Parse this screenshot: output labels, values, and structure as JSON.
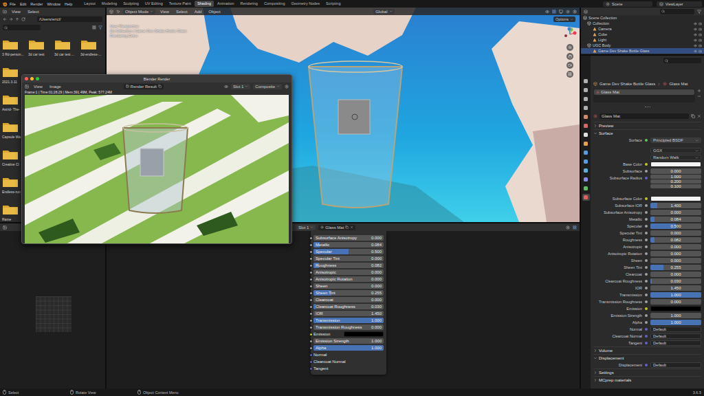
{
  "topbar": {
    "menus": [
      "File",
      "Edit",
      "Render",
      "Window",
      "Help"
    ],
    "workspaces": [
      {
        "label": "Layout",
        "selected": false
      },
      {
        "label": "Modeling",
        "selected": false
      },
      {
        "label": "Sculpting",
        "selected": false
      },
      {
        "label": "UV Editing",
        "selected": false
      },
      {
        "label": "Texture Paint",
        "selected": false
      },
      {
        "label": "Shading",
        "selected": true
      },
      {
        "label": "Animation",
        "selected": false
      },
      {
        "label": "Rendering",
        "selected": false
      },
      {
        "label": "Compositing",
        "selected": false
      },
      {
        "label": "Geometry Nodes",
        "selected": false
      },
      {
        "label": "Scripting",
        "selected": false
      }
    ],
    "scene": "Scene",
    "view_layer": "ViewLayer"
  },
  "file_browser": {
    "menus": [
      "View",
      "Select"
    ],
    "path": "/Users/ericl/",
    "rows": [
      [
        "3 Rd-person...",
        "3d car test",
        "3d car test ...",
        "3d-endless-..."
      ],
      [
        "2021.3.11"
      ],
      [
        "Astrid- The-"
      ],
      [
        "Capsule Wa"
      ],
      [
        "Creative Cl"
      ],
      [
        "Endless-run"
      ],
      [
        "Rame"
      ]
    ]
  },
  "viewport": {
    "mode": "Object Mode",
    "menus": [
      "View",
      "Select",
      "Add",
      "Object"
    ],
    "orientation": "Global",
    "options": "Options",
    "overlay": [
      "User Perspective",
      "(1) Collection | Game Dev Shake Bottle Glass",
      "Rendering Done"
    ]
  },
  "render_window": {
    "title": "Blender Render",
    "menus": [
      "View",
      "Image"
    ],
    "image": "Render Result",
    "slot": "Slot 1",
    "pass": "Composite",
    "info": "Frame:1 | Time:01:28.29 | Mem:391.49M, Peak: 577.24M"
  },
  "node_editor": {
    "slot": "Slot 1",
    "material": "Glass Mat",
    "rows": [
      {
        "kind": "slider",
        "label": "Subsurface Anisotropy",
        "value": "0.000",
        "level": 0
      },
      {
        "kind": "slider",
        "label": "Metallic",
        "value": "0.084",
        "level": 0.084
      },
      {
        "kind": "slider",
        "label": "Specular",
        "value": "0.500",
        "level": 0.5
      },
      {
        "kind": "slider",
        "label": "Specular Tint",
        "value": "0.000",
        "level": 0
      },
      {
        "kind": "slider",
        "label": "Roughness",
        "value": "0.082",
        "level": 0.082
      },
      {
        "kind": "slider",
        "label": "Anisotropic",
        "value": "0.000",
        "level": 0
      },
      {
        "kind": "slider",
        "label": "Anisotropic Rotation",
        "value": "0.000",
        "level": 0
      },
      {
        "kind": "slider",
        "label": "Sheen",
        "value": "0.000",
        "level": 0
      },
      {
        "kind": "slider",
        "label": "Sheen Tint",
        "value": "0.255",
        "level": 0.255
      },
      {
        "kind": "slider",
        "label": "Clearcoat",
        "value": "0.000",
        "level": 0
      },
      {
        "kind": "slider",
        "label": "Clearcoat Roughness",
        "value": "0.030",
        "level": 0.03
      },
      {
        "kind": "number",
        "label": "IOR",
        "value": "1.450"
      },
      {
        "kind": "slider",
        "label": "Transmission",
        "value": "1.000",
        "level": 1
      },
      {
        "kind": "slider",
        "label": "Transmission Roughness",
        "value": "0.000",
        "level": 0
      },
      {
        "kind": "color",
        "label": "Emission",
        "color": "#000000"
      },
      {
        "kind": "number",
        "label": "Emission Strength",
        "value": "1.000"
      },
      {
        "kind": "slider",
        "label": "Alpha",
        "value": "1.000",
        "level": 1
      },
      {
        "kind": "socket",
        "label": "Normal"
      },
      {
        "kind": "socket",
        "label": "Clearcoat Normal"
      },
      {
        "kind": "socket",
        "label": "Tangent"
      }
    ]
  },
  "outliner": {
    "items": [
      {
        "label": "Scene Collection",
        "kind": "root",
        "selected": false
      },
      {
        "label": "Collection",
        "kind": "collection",
        "selected": false
      },
      {
        "label": "Camera",
        "kind": "object",
        "selected": false
      },
      {
        "label": "Cube",
        "kind": "object",
        "selected": false
      },
      {
        "label": "Light",
        "kind": "object",
        "selected": false
      },
      {
        "label": "UGC Body",
        "kind": "collection",
        "selected": false
      },
      {
        "label": "Game Dev Shake Bottle Glass",
        "kind": "object",
        "selected": true
      }
    ]
  },
  "properties": {
    "tabs": [
      {
        "color": "#b0b0b0",
        "selected": false
      },
      {
        "color": "#b0b0b0",
        "selected": false
      },
      {
        "color": "#b0b0b0",
        "selected": false
      },
      {
        "color": "#b0b0b0",
        "selected": false
      },
      {
        "color": "#d08a6a",
        "selected": false
      },
      {
        "color": "#d06a6a",
        "selected": false
      },
      {
        "color": "#e0e0e0",
        "selected": false
      },
      {
        "color": "#e8a050",
        "selected": false
      },
      {
        "color": "#5a9ae0",
        "selected": false
      },
      {
        "color": "#5a9ae0",
        "selected": false
      },
      {
        "color": "#5ab0e0",
        "selected": false
      },
      {
        "color": "#8a8ae0",
        "selected": false
      },
      {
        "color": "#60c060",
        "selected": false
      },
      {
        "color": "#e06060",
        "selected": true
      }
    ],
    "breadcrumb": [
      "Game Dev Shake Bottle Glass",
      "Glass Mat"
    ],
    "slots": [
      {
        "label": "Glass Mat",
        "selected": true
      }
    ],
    "material": "Glass Mat",
    "rows": [
      {
        "kind": "section",
        "label": "Preview",
        "expanded": false
      },
      {
        "kind": "section",
        "label": "Surface",
        "expanded": true
      },
      {
        "kind": "shader",
        "label": "Surface",
        "value": "Principled BSDF"
      },
      {
        "kind": "select",
        "value": "GGX"
      },
      {
        "kind": "select",
        "value": "Random Walk"
      },
      {
        "kind": "color",
        "label": "Base Color",
        "color": "#f2f2f2"
      },
      {
        "kind": "slider",
        "label": "Subsurface",
        "value": "0.000",
        "level": 0
      },
      {
        "kind": "vector",
        "label": "Subsurface Radius",
        "values": [
          "1.000",
          "0.200",
          "0.100"
        ]
      },
      {
        "kind": "color",
        "label": "Subsurface Color",
        "color": "#f2f2f2"
      },
      {
        "kind": "slider",
        "label": "Subsurface IOR",
        "value": "1.400",
        "level": 0.14
      },
      {
        "kind": "slider",
        "label": "Subsurface Anisotropy",
        "value": "0.000",
        "level": 0
      },
      {
        "kind": "slider",
        "label": "Metallic",
        "value": "0.084",
        "level": 0.084
      },
      {
        "kind": "slider",
        "label": "Specular",
        "value": "0.500",
        "level": 0.5
      },
      {
        "kind": "slider",
        "label": "Specular Tint",
        "value": "0.000",
        "level": 0
      },
      {
        "kind": "slider",
        "label": "Roughness",
        "value": "0.082",
        "level": 0.082
      },
      {
        "kind": "slider",
        "label": "Anisotropic",
        "value": "0.000",
        "level": 0
      },
      {
        "kind": "slider",
        "label": "Anisotropic Rotation",
        "value": "0.000",
        "level": 0
      },
      {
        "kind": "slider",
        "label": "Sheen",
        "value": "0.000",
        "level": 0
      },
      {
        "kind": "slider",
        "label": "Sheen Tint",
        "value": "0.255",
        "level": 0.255
      },
      {
        "kind": "slider",
        "label": "Clearcoat",
        "value": "0.000",
        "level": 0
      },
      {
        "kind": "slider",
        "label": "Clearcoat Roughness",
        "value": "0.030",
        "level": 0.03
      },
      {
        "kind": "number",
        "label": "IOR",
        "value": "1.450"
      },
      {
        "kind": "slider",
        "label": "Transmission",
        "value": "1.000",
        "level": 1
      },
      {
        "kind": "slider",
        "label": "Transmission Roughness",
        "value": "0.000",
        "level": 0
      },
      {
        "kind": "color",
        "label": "Emission",
        "color": "#000000"
      },
      {
        "kind": "number",
        "label": "Emission Strength",
        "value": "1.000"
      },
      {
        "kind": "slider",
        "label": "Alpha",
        "value": "1.000",
        "level": 1
      },
      {
        "kind": "link",
        "label": "Normal",
        "value": "Default"
      },
      {
        "kind": "link",
        "label": "Clearcoat Normal",
        "value": "Default"
      },
      {
        "kind": "link",
        "label": "Tangent",
        "value": "Default"
      },
      {
        "kind": "section",
        "label": "Volume",
        "expanded": false
      },
      {
        "kind": "section",
        "label": "Displacement",
        "expanded": true
      },
      {
        "kind": "link",
        "label": "Displacement",
        "value": "Default"
      },
      {
        "kind": "section",
        "label": "Settings",
        "expanded": false
      },
      {
        "kind": "section",
        "label": "MCprep materials",
        "expanded": false
      }
    ]
  },
  "status_bar": {
    "items": [
      "Select",
      "Rotate View",
      "Object Context Menu"
    ],
    "version": "3.6.5"
  }
}
